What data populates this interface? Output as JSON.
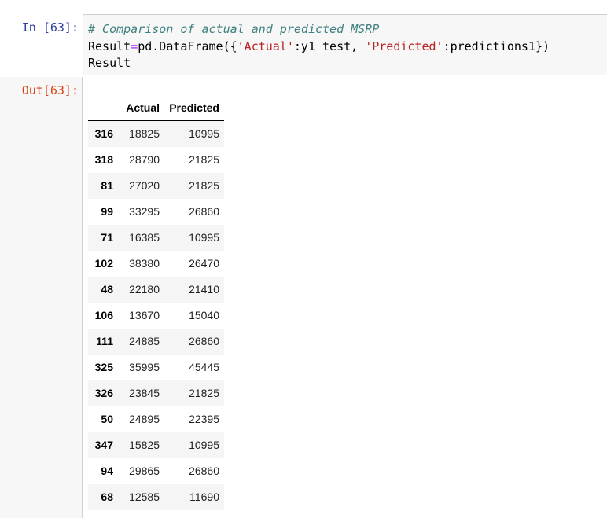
{
  "input_cell": {
    "prompt": "In [63]:",
    "code": {
      "comment": "# Comparison of actual and predicted MSRP",
      "line2_var": "Result",
      "line2_eq": "=",
      "line2_mid1": "pd.DataFrame({",
      "line2_str1": "'Actual'",
      "line2_mid2": ":y1_test, ",
      "line2_str2": "'Predicted'",
      "line2_mid3": ":predictions1})",
      "line3": "Result"
    }
  },
  "output_cell": {
    "prompt": "Out[63]:",
    "table": {
      "columns": [
        "Actual",
        "Predicted"
      ],
      "rows": [
        {
          "index": "316",
          "actual": "18825",
          "predicted": "10995"
        },
        {
          "index": "318",
          "actual": "28790",
          "predicted": "21825"
        },
        {
          "index": "81",
          "actual": "27020",
          "predicted": "21825"
        },
        {
          "index": "99",
          "actual": "33295",
          "predicted": "26860"
        },
        {
          "index": "71",
          "actual": "16385",
          "predicted": "10995"
        },
        {
          "index": "102",
          "actual": "38380",
          "predicted": "26470"
        },
        {
          "index": "48",
          "actual": "22180",
          "predicted": "21410"
        },
        {
          "index": "106",
          "actual": "13670",
          "predicted": "15040"
        },
        {
          "index": "111",
          "actual": "24885",
          "predicted": "26860"
        },
        {
          "index": "325",
          "actual": "35995",
          "predicted": "45445"
        },
        {
          "index": "326",
          "actual": "23845",
          "predicted": "21825"
        },
        {
          "index": "50",
          "actual": "24895",
          "predicted": "22395"
        },
        {
          "index": "347",
          "actual": "15825",
          "predicted": "10995"
        },
        {
          "index": "94",
          "actual": "29865",
          "predicted": "26860"
        },
        {
          "index": "68",
          "actual": "12585",
          "predicted": "11690"
        }
      ]
    }
  }
}
